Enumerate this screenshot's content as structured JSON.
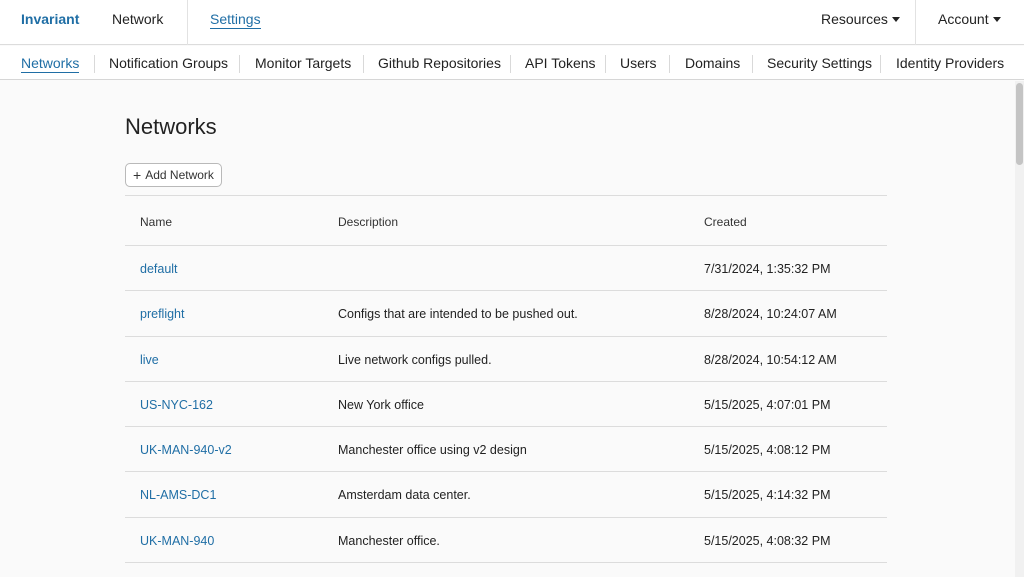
{
  "app": {
    "brand": "Invariant"
  },
  "topnav": {
    "network": "Network",
    "settings": "Settings",
    "resources": "Resources",
    "account": "Account"
  },
  "subnav": [
    "Networks",
    "Notification Groups",
    "Monitor Targets",
    "Github Repositories",
    "API Tokens",
    "Users",
    "Domains",
    "Security Settings",
    "Identity Providers"
  ],
  "main": {
    "title": "Networks",
    "add_button": "Add Network",
    "columns": [
      "Name",
      "Description",
      "Created"
    ],
    "rows": [
      {
        "name": "default",
        "description": "",
        "created": "7/31/2024, 1:35:32 PM"
      },
      {
        "name": "preflight",
        "description": "Configs that are intended to be pushed out.",
        "created": "8/28/2024, 10:24:07 AM"
      },
      {
        "name": "live",
        "description": "Live network configs pulled.",
        "created": "8/28/2024, 10:54:12 AM"
      },
      {
        "name": "US-NYC-162",
        "description": "New York office",
        "created": "5/15/2025, 4:07:01 PM"
      },
      {
        "name": "UK-MAN-940-v2",
        "description": "Manchester office using v2 design",
        "created": "5/15/2025, 4:08:12 PM"
      },
      {
        "name": "NL-AMS-DC1",
        "description": "Amsterdam data center.",
        "created": "5/15/2025, 4:14:32 PM"
      },
      {
        "name": "UK-MAN-940",
        "description": "Manchester office.",
        "created": "5/15/2025, 4:08:32 PM"
      }
    ]
  },
  "colors": {
    "accent": "#1f6ea5",
    "border": "#dcdcdc",
    "background": "#fafafa"
  },
  "icons": {
    "add": "plus-icon",
    "dropdown": "caret-down-icon"
  }
}
